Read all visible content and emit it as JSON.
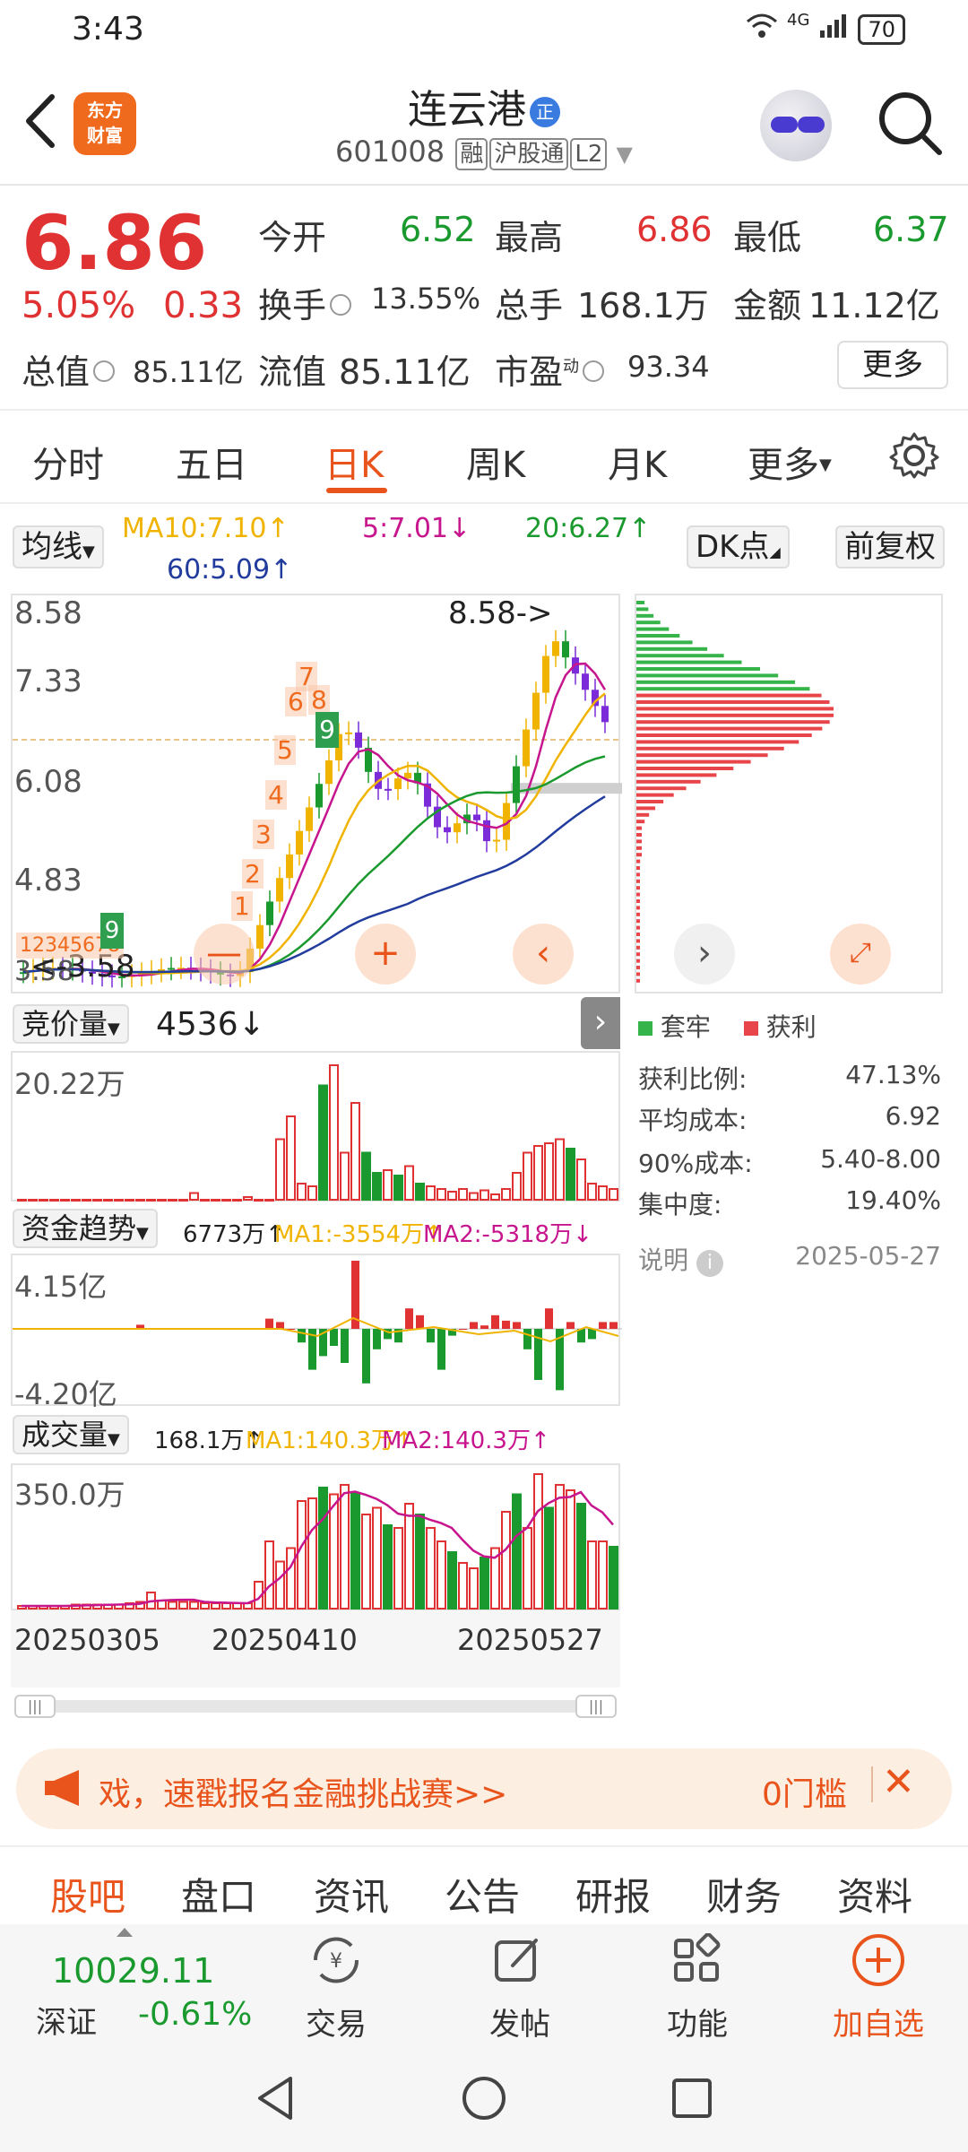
{
  "status_bar": {
    "time": "3:43",
    "network": "4G",
    "battery": "70"
  },
  "header": {
    "logo_text": "东方财富",
    "stock_name": "连云港",
    "name_badge": "正",
    "stock_code": "601008",
    "tags": [
      "融",
      "沪股通",
      "L2"
    ]
  },
  "quote": {
    "price": "6.86",
    "change_pct": "5.05%",
    "change_amt": "0.33",
    "open_label": "今开",
    "open": "6.52",
    "high_label": "最高",
    "high": "6.86",
    "low_label": "最低",
    "low": "6.37",
    "turnover_label": "换手",
    "turnover": "13.55%",
    "volume_label": "总手",
    "volume": "168.1万",
    "amount_label": "金额",
    "amount": "11.12亿",
    "mcap_label": "总值",
    "mcap": "85.11亿",
    "float_label": "流值",
    "float": "85.11亿",
    "pe_label": "市盈",
    "pe_sup": "动",
    "pe": "93.34",
    "more_label": "更多"
  },
  "tabs": [
    "分时",
    "五日",
    "日K",
    "周K",
    "月K",
    "更多"
  ],
  "ma_row": {
    "selector": "均线",
    "ma10": "MA10:7.10↑",
    "ma5": "5:7.01↓",
    "ma20": "20:6.27↑",
    "ma60": "60:5.09↑",
    "dk_button": "DK点",
    "adjust_button": "前复权"
  },
  "kline": {
    "y_labels": [
      "8.58",
      "7.33",
      "6.08",
      "4.83",
      "3.58"
    ],
    "high_marker": "8.58->",
    "low_marker": "<-3.58",
    "signal_numbers": [
      "1",
      "2",
      "3",
      "4",
      "5",
      "6",
      "7",
      "8",
      "9"
    ],
    "nine_green": "9",
    "left_overlay": "12345678",
    "colors": {
      "up": "#e03232",
      "down": "#1a9a2e",
      "ma5": "#c7158e",
      "ma10": "#f0b400",
      "ma20": "#1a9a2e",
      "ma60": "#223c9e"
    }
  },
  "chip": {
    "legend_trapped": "套牢",
    "legend_profit": "获利",
    "stats": [
      {
        "label": "获利比例:",
        "value": "47.13%"
      },
      {
        "label": "平均成本:",
        "value": "6.92"
      },
      {
        "label": "90%成本:",
        "value": "5.40-8.00"
      },
      {
        "label": "集中度:",
        "value": "19.40%"
      }
    ],
    "note_label": "说明",
    "date": "2025-05-27"
  },
  "auction": {
    "selector": "竞价量",
    "value": "4536↓",
    "y_label": "20.22万"
  },
  "fund": {
    "selector": "资金趋势",
    "value": "6773万↑",
    "ma1": "MA1:-3554万↑",
    "ma2": "MA2:-5318万↓",
    "y_top": "4.15亿",
    "y_bottom": "-4.20亿"
  },
  "volume_panel": {
    "selector": "成交量",
    "value": "168.1万↑",
    "ma1": "MA1:140.3万↑",
    "ma2": "MA2:140.3万↑",
    "y_label": "350.0万"
  },
  "dates": [
    "20250305",
    "20250410",
    "20250527"
  ],
  "banner": {
    "text": "戏，速戳报名金融挑战赛>>",
    "right": "0门槛"
  },
  "bottom_tabs": [
    "股吧",
    "盘口",
    "资讯",
    "公告",
    "研报",
    "财务",
    "资料"
  ],
  "bottom_nav": {
    "index_value": "10029.11",
    "index_name": "深证",
    "index_change": "-0.61%",
    "items": [
      "交易",
      "发帖",
      "功能",
      "加自选"
    ]
  }
}
